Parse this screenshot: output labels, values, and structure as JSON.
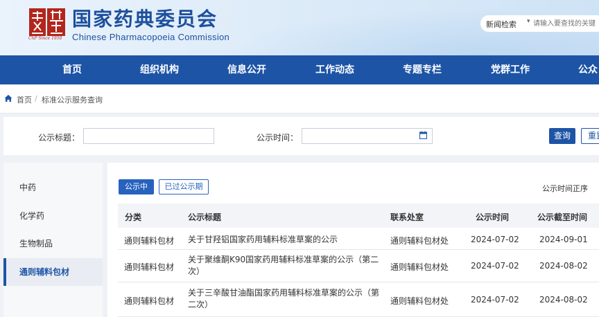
{
  "header": {
    "title": "国家药典委员会",
    "subtitle": "Chinese Pharmacopoeia Commission",
    "logo_text": "ChP Since 1950",
    "search": {
      "category": "新闻检索",
      "placeholder": "请输入要查找的关键"
    }
  },
  "nav": {
    "items": [
      "首页",
      "组织机构",
      "信息公开",
      "工作动态",
      "专题专栏",
      "党群工作",
      "公众"
    ]
  },
  "breadcrumb": {
    "home": "首页",
    "current": "标准公示服务查询"
  },
  "filter": {
    "title_label": "公示标题：",
    "time_label": "公示时间：",
    "query_button": "查询",
    "reset_button": "重置"
  },
  "sidebar": {
    "items": [
      "中药",
      "化学药",
      "生物制品",
      "通则辅料包材"
    ],
    "active": "通则辅料包材"
  },
  "tabs": {
    "active": "公示中",
    "other": "已过公示期"
  },
  "sort_label": "公示时间正序",
  "table": {
    "headers": [
      "分类",
      "公示标题",
      "联系处室",
      "公示时间",
      "公示截至时间"
    ],
    "rows": [
      {
        "category": "通则辅料包材",
        "title": "关于甘羟铝国家药用辅料标准草案的公示",
        "dept": "通则辅料包材处",
        "date": "2024-07-02",
        "deadline": "2024-09-01"
      },
      {
        "category": "通则辅料包材",
        "title": "关于聚维酮K90国家药用辅料标准草案的公示（第二次）",
        "dept": "通则辅料包材处",
        "date": "2024-07-02",
        "deadline": "2024-08-02"
      },
      {
        "category": "通则辅料包材",
        "title": "关于三辛酸甘油酯国家药用辅料标准草案的公示（第二次）",
        "dept": "通则辅料包材处",
        "date": "2024-07-02",
        "deadline": "2024-08-02"
      }
    ]
  },
  "colors": {
    "brand": "#1d54a6",
    "title": "#1d4f9c",
    "logo_red": "#b3261e"
  }
}
